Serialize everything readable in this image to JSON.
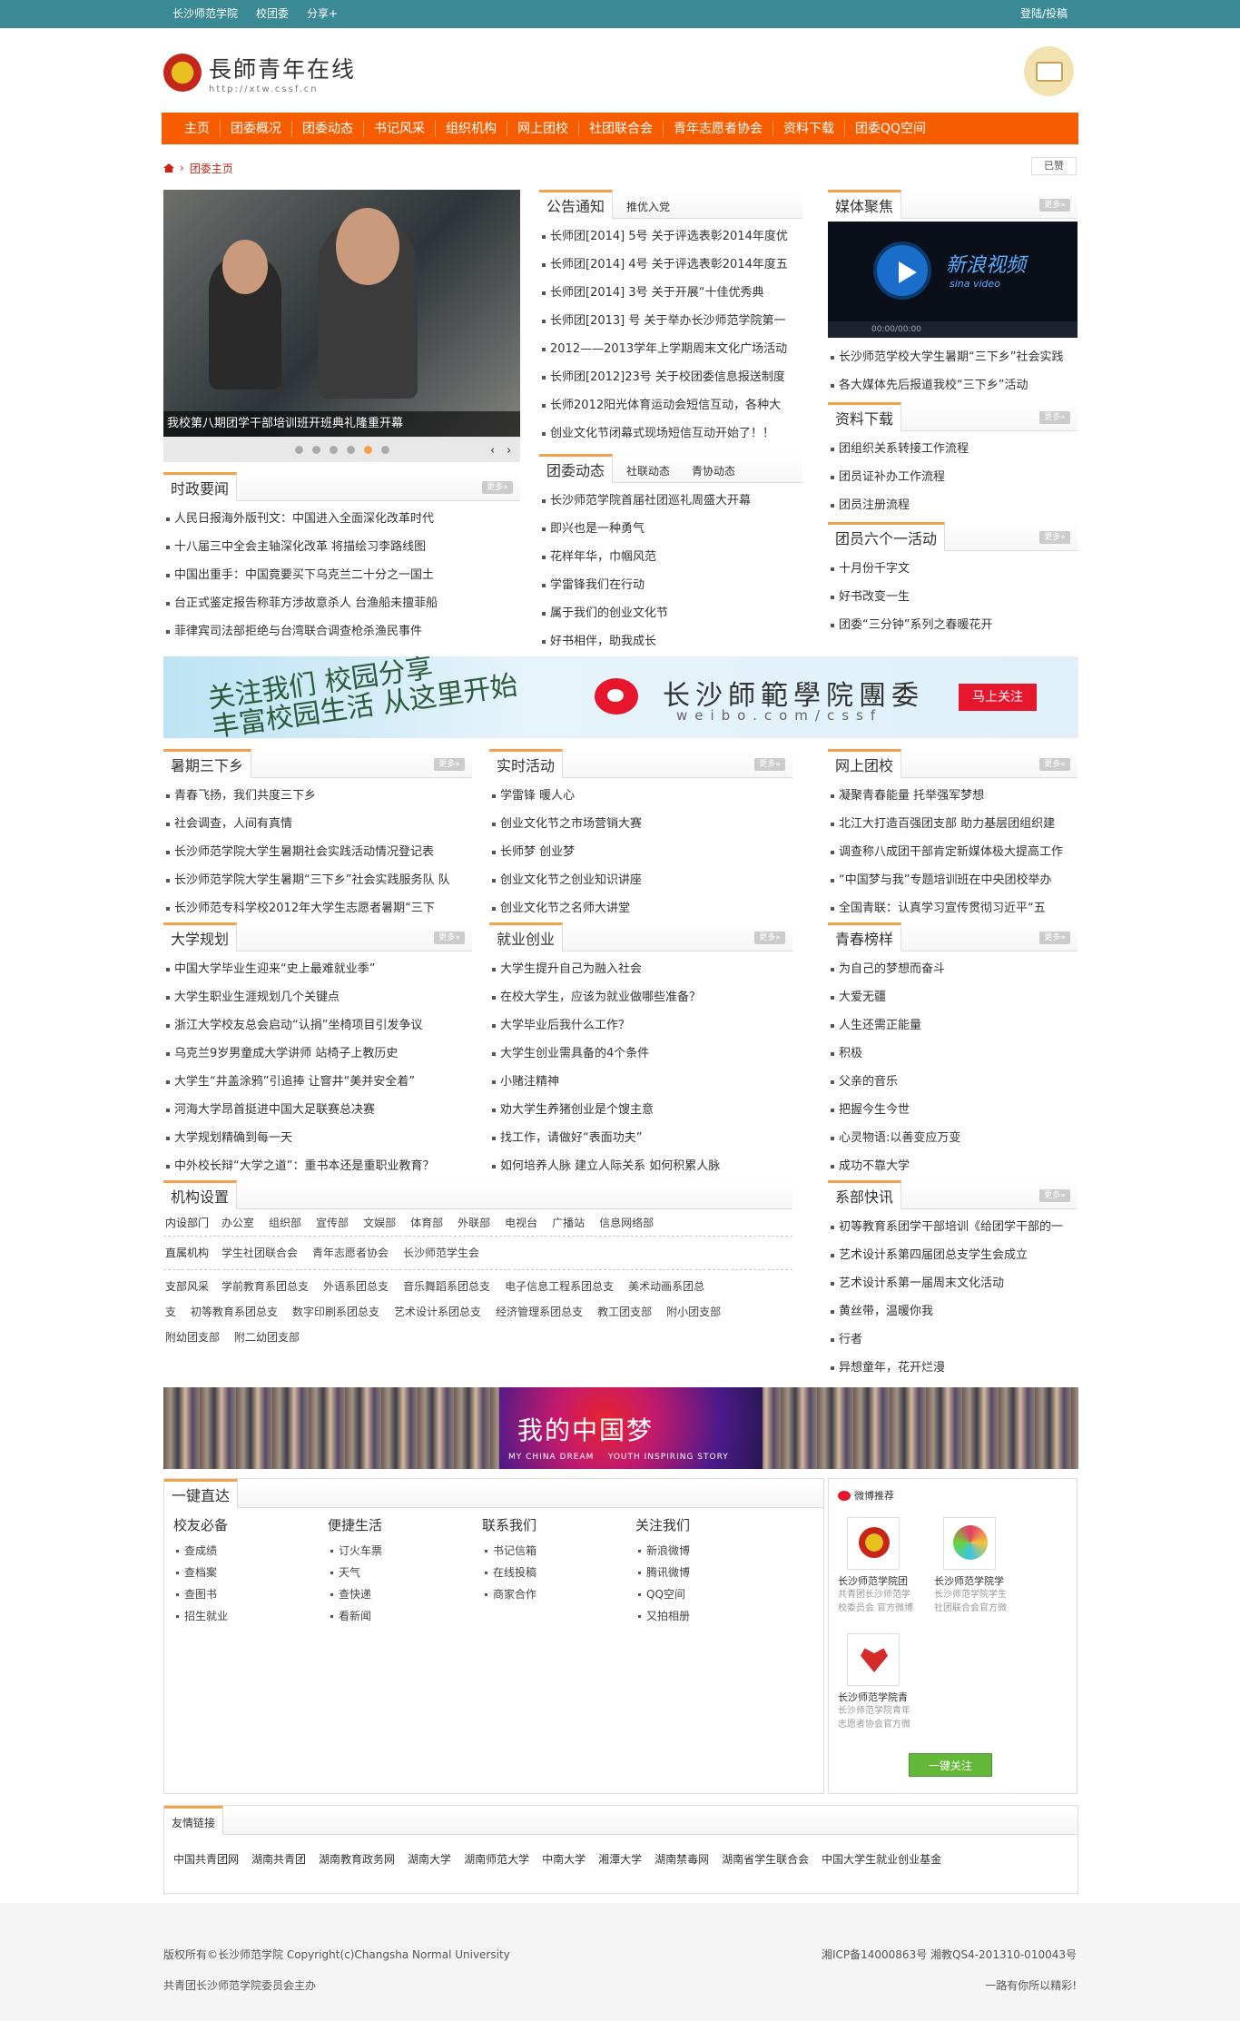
{
  "topbar": {
    "links": [
      "长沙师范学院",
      "校团委",
      "分享+"
    ],
    "login": "登陆/投稿"
  },
  "logo": {
    "title": "長師青年在线",
    "url": "http://xtw.cssf.cn"
  },
  "nav": [
    "主页",
    "团委概况",
    "团委动态",
    "书记风采",
    "组织机构",
    "网上团校",
    "社团联合会",
    "青年志愿者协会",
    "资料下载",
    "团委QQ空间"
  ],
  "breadcrumb": {
    "current": "团委主页"
  },
  "share": {
    "label": "已赞"
  },
  "slide": {
    "caption": "我校第八期团学干部培训班开班典礼隆重开幕",
    "arrows": [
      "‹",
      "›"
    ]
  },
  "more": "更多»",
  "notice": {
    "title": "公告通知",
    "tab": "推优入党",
    "items": [
      "长师团[2014] 5号 关于评选表彰2014年度优",
      "长师团[2014] 4号 关于评选表彰2014年度五",
      "长师团[2014] 3号 关于开展“十佳优秀典",
      "长师团[2013] 号 关于举办长沙师范学院第一",
      "2012——2013学年上学期周末文化广场活动",
      "长师团[2012]23号 关于校团委信息报送制度",
      "长师2012阳光体育运动会短信互动，各种大",
      "创业文化节闭幕式现场短信互动开始了！！"
    ]
  },
  "media": {
    "title": "媒体聚焦",
    "video_title": "新浪视频",
    "video_sub": "sina video",
    "video_time": "00:00/00:00",
    "items": [
      "长沙师范学校大学生暑期“三下乡”社会实践",
      "各大媒体先后报道我校“三下乡”活动"
    ]
  },
  "politics": {
    "title": "时政要闻",
    "items": [
      "人民日报海外版刊文：中国进入全面深化改革时代",
      "十八届三中全会主轴深化改革 将描绘习李路线图",
      "中国出重手：中国竟要买下乌克兰二十分之一国土",
      "台正式鉴定报告称菲方涉故意杀人 台渔船未擅菲船",
      "菲律宾司法部拒绝与台湾联合调查枪杀渔民事件"
    ]
  },
  "dynamics": {
    "title": "团委动态",
    "tabs": [
      "社联动态",
      "青协动态"
    ],
    "items": [
      "长沙师范学院首届社团巡礼周盛大开幕",
      "即兴也是一种勇气",
      "花样年华，巾帼风范",
      "学雷锋我们在行动",
      "属于我们的创业文化节",
      "好书相伴，助我成长"
    ]
  },
  "downloads": {
    "title": "资料下载",
    "items": [
      "团组织关系转接工作流程",
      "团员证补办工作流程",
      "团员注册流程"
    ]
  },
  "six": {
    "title": "团员六个一活动",
    "items": [
      "十月份千字文",
      "好书改变一生",
      "团委“三分钟”系列之春暖花开"
    ]
  },
  "banner": {
    "slogan1": "关注我们",
    "slogan2": "丰富校园生活",
    "slogan3": "校园分享",
    "slogan4": "从这里开始",
    "name": "长沙師範學院團委",
    "url": "weibo.com/cssf",
    "button": "马上关注"
  },
  "summer": {
    "title": "暑期三下乡",
    "items": [
      "青春飞扬，我们共度三下乡",
      "社会调查，人间有真情",
      "长沙师范学院大学生暑期社会实践活动情况登记表",
      "长沙师范学院大学生暑期“三下乡”社会实践服务队 队",
      "长沙师范专科学校2012年大学生志愿者暑期“三下"
    ]
  },
  "practice": {
    "title": "实时活动",
    "items": [
      "学雷锋 暖人心",
      "创业文化节之市场营销大赛",
      "长师梦 创业梦",
      "创业文化节之创业知识讲座",
      "创业文化节之名师大讲堂"
    ]
  },
  "online": {
    "title": "网上团校",
    "items": [
      "凝聚青春能量 托举强军梦想",
      "北江大打造百强团支部 助力基层团组织建",
      "调查称八成团干部肯定新媒体极大提高工作",
      "“中国梦与我”专题培训班在中央团校举办",
      "全国青联：认真学习宣传贯彻习近平“五"
    ]
  },
  "plan": {
    "title": "大学规划",
    "items": [
      "中国大学毕业生迎来“史上最难就业季”",
      "大学生职业生涯规划几个关键点",
      "浙江大学校友总会启动“认捐”坐椅项目引发争议",
      "乌克兰9岁男童成大学讲师 站椅子上教历史",
      "大学生“井盖涂鸦”引追捧 让窨井“美并安全着”",
      "河海大学昂首挺进中国大足联赛总决赛",
      "大学规划精确到每一天",
      "中外校长辩“大学之道”：重书本还是重职业教育？"
    ]
  },
  "career": {
    "title": "就业创业",
    "items": [
      "大学生提升自己为融入社会",
      "在校大学生，应该为就业做哪些准备？",
      "大学毕业后我什么工作？",
      "大学生创业需具备的4个条件",
      "小赌注精神",
      "劝大学生养猪创业是个馊主意",
      "找工作，请做好“表面功夫”",
      "如何培养人脉 建立人际关系 如何积累人脉"
    ]
  },
  "youth": {
    "title": "青春榜样",
    "items": [
      "为自己的梦想而奋斗",
      "大爱无疆",
      "人生还需正能量",
      "积极",
      "父亲的音乐",
      "把握今生今世",
      "心灵物语:以善变应万变",
      "成功不靠大学"
    ]
  },
  "org": {
    "title": "机构设置",
    "row1": [
      "内设部门",
      "办公室",
      "组织部",
      "宣传部",
      "文娱部",
      "体育部",
      "外联部",
      "电视台",
      "广播站",
      "信息网络部"
    ],
    "row2": [
      "直属机构",
      "学生社团联合会",
      "青年志愿者协会",
      "长沙师范学生会"
    ],
    "row3a": [
      "支部风采",
      "学前教育系团总支",
      "外语系团总支",
      "音乐舞蹈系团总支",
      "电子信息工程系团总支",
      "美术动画系团总"
    ],
    "row3b": [
      "支",
      "初等教育系团总支",
      "数字印刷系团总支",
      "艺术设计系团总支",
      "经济管理系团总支",
      "教工团支部",
      "附小团支部"
    ],
    "row3c": [
      "附幼团支部",
      "附二幼团支部"
    ]
  },
  "dept": {
    "title": "系部快讯",
    "items": [
      "初等教育系团学干部培训《给团学干部的一",
      "艺术设计系第四届团总支学生会成立",
      "艺术设计系第一届周末文化活动",
      "黄丝带，温暖你我",
      "行者",
      "异想童年，花开烂漫"
    ]
  },
  "dream": {
    "title": "我的中国梦",
    "sub1": "MY CHINA DREAM",
    "sub2": "YOUTH INSPIRING STORY"
  },
  "quick": {
    "title": "一键直达",
    "cols": [
      {
        "h": "校友必备",
        "items": [
          "查成绩",
          "查档案",
          "查图书",
          "招生就业"
        ]
      },
      {
        "h": "便捷生活",
        "items": [
          "订火车票",
          "天气",
          "查快递",
          "看新闻"
        ]
      },
      {
        "h": "联系我们",
        "items": [
          "书记信箱",
          "在线投稿",
          "商家合作"
        ]
      },
      {
        "h": "关注我们",
        "items": [
          "新浪微博",
          "腾讯微博",
          "QQ空间",
          "又拍相册"
        ]
      }
    ]
  },
  "weibo_rec": {
    "title": "微博推荐",
    "accounts": [
      {
        "name": "长沙师范学院团",
        "desc": "共青团长沙师范学",
        "desc2": "校委员会 官方微博"
      },
      {
        "name": "长沙师范学院学",
        "desc": "长沙师范学院学生",
        "desc2": "社团联合会官方微"
      },
      {
        "name": "长沙师范学院青",
        "desc": "长沙师范学院青年",
        "desc2": "志愿者协会官方微"
      }
    ],
    "button": "一键关注"
  },
  "friend": {
    "title": "友情链接",
    "links": [
      "中国共青团网",
      "湖南共青团",
      "湖南教育政务网",
      "湖南大学",
      "湖南师范大学",
      "中南大学",
      "湘潭大学",
      "湖南禁毒网",
      "湖南省学生联合会",
      "中国大学生就业创业基金"
    ]
  },
  "footer": {
    "left1": "版权所有©长沙师范学院 Copyright(c)Changsha Normal University",
    "left2": "共青团长沙师范学院委员会主办",
    "right1": "湘ICP备14000863号 湘教QS4-201310-010043号",
    "right2": "一路有你所以精彩!"
  }
}
